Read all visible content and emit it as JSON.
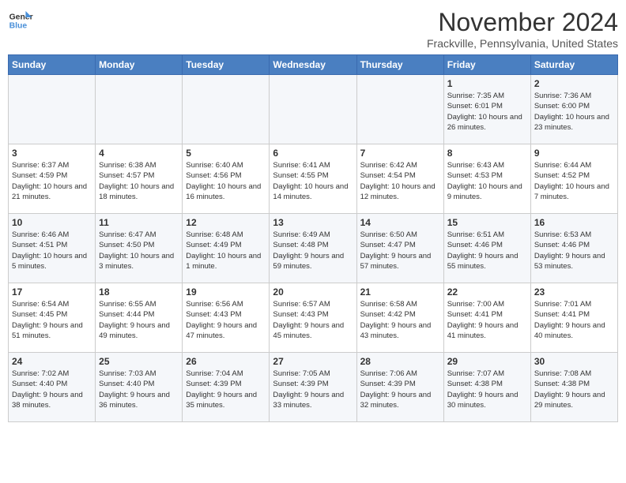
{
  "logo": {
    "line1": "General",
    "line2": "Blue"
  },
  "title": "November 2024",
  "subtitle": "Frackville, Pennsylvania, United States",
  "weekdays": [
    "Sunday",
    "Monday",
    "Tuesday",
    "Wednesday",
    "Thursday",
    "Friday",
    "Saturday"
  ],
  "weeks": [
    [
      {
        "day": "",
        "info": ""
      },
      {
        "day": "",
        "info": ""
      },
      {
        "day": "",
        "info": ""
      },
      {
        "day": "",
        "info": ""
      },
      {
        "day": "",
        "info": ""
      },
      {
        "day": "1",
        "info": "Sunrise: 7:35 AM\nSunset: 6:01 PM\nDaylight: 10 hours and 26 minutes."
      },
      {
        "day": "2",
        "info": "Sunrise: 7:36 AM\nSunset: 6:00 PM\nDaylight: 10 hours and 23 minutes."
      }
    ],
    [
      {
        "day": "3",
        "info": "Sunrise: 6:37 AM\nSunset: 4:59 PM\nDaylight: 10 hours and 21 minutes."
      },
      {
        "day": "4",
        "info": "Sunrise: 6:38 AM\nSunset: 4:57 PM\nDaylight: 10 hours and 18 minutes."
      },
      {
        "day": "5",
        "info": "Sunrise: 6:40 AM\nSunset: 4:56 PM\nDaylight: 10 hours and 16 minutes."
      },
      {
        "day": "6",
        "info": "Sunrise: 6:41 AM\nSunset: 4:55 PM\nDaylight: 10 hours and 14 minutes."
      },
      {
        "day": "7",
        "info": "Sunrise: 6:42 AM\nSunset: 4:54 PM\nDaylight: 10 hours and 12 minutes."
      },
      {
        "day": "8",
        "info": "Sunrise: 6:43 AM\nSunset: 4:53 PM\nDaylight: 10 hours and 9 minutes."
      },
      {
        "day": "9",
        "info": "Sunrise: 6:44 AM\nSunset: 4:52 PM\nDaylight: 10 hours and 7 minutes."
      }
    ],
    [
      {
        "day": "10",
        "info": "Sunrise: 6:46 AM\nSunset: 4:51 PM\nDaylight: 10 hours and 5 minutes."
      },
      {
        "day": "11",
        "info": "Sunrise: 6:47 AM\nSunset: 4:50 PM\nDaylight: 10 hours and 3 minutes."
      },
      {
        "day": "12",
        "info": "Sunrise: 6:48 AM\nSunset: 4:49 PM\nDaylight: 10 hours and 1 minute."
      },
      {
        "day": "13",
        "info": "Sunrise: 6:49 AM\nSunset: 4:48 PM\nDaylight: 9 hours and 59 minutes."
      },
      {
        "day": "14",
        "info": "Sunrise: 6:50 AM\nSunset: 4:47 PM\nDaylight: 9 hours and 57 minutes."
      },
      {
        "day": "15",
        "info": "Sunrise: 6:51 AM\nSunset: 4:46 PM\nDaylight: 9 hours and 55 minutes."
      },
      {
        "day": "16",
        "info": "Sunrise: 6:53 AM\nSunset: 4:46 PM\nDaylight: 9 hours and 53 minutes."
      }
    ],
    [
      {
        "day": "17",
        "info": "Sunrise: 6:54 AM\nSunset: 4:45 PM\nDaylight: 9 hours and 51 minutes."
      },
      {
        "day": "18",
        "info": "Sunrise: 6:55 AM\nSunset: 4:44 PM\nDaylight: 9 hours and 49 minutes."
      },
      {
        "day": "19",
        "info": "Sunrise: 6:56 AM\nSunset: 4:43 PM\nDaylight: 9 hours and 47 minutes."
      },
      {
        "day": "20",
        "info": "Sunrise: 6:57 AM\nSunset: 4:43 PM\nDaylight: 9 hours and 45 minutes."
      },
      {
        "day": "21",
        "info": "Sunrise: 6:58 AM\nSunset: 4:42 PM\nDaylight: 9 hours and 43 minutes."
      },
      {
        "day": "22",
        "info": "Sunrise: 7:00 AM\nSunset: 4:41 PM\nDaylight: 9 hours and 41 minutes."
      },
      {
        "day": "23",
        "info": "Sunrise: 7:01 AM\nSunset: 4:41 PM\nDaylight: 9 hours and 40 minutes."
      }
    ],
    [
      {
        "day": "24",
        "info": "Sunrise: 7:02 AM\nSunset: 4:40 PM\nDaylight: 9 hours and 38 minutes."
      },
      {
        "day": "25",
        "info": "Sunrise: 7:03 AM\nSunset: 4:40 PM\nDaylight: 9 hours and 36 minutes."
      },
      {
        "day": "26",
        "info": "Sunrise: 7:04 AM\nSunset: 4:39 PM\nDaylight: 9 hours and 35 minutes."
      },
      {
        "day": "27",
        "info": "Sunrise: 7:05 AM\nSunset: 4:39 PM\nDaylight: 9 hours and 33 minutes."
      },
      {
        "day": "28",
        "info": "Sunrise: 7:06 AM\nSunset: 4:39 PM\nDaylight: 9 hours and 32 minutes."
      },
      {
        "day": "29",
        "info": "Sunrise: 7:07 AM\nSunset: 4:38 PM\nDaylight: 9 hours and 30 minutes."
      },
      {
        "day": "30",
        "info": "Sunrise: 7:08 AM\nSunset: 4:38 PM\nDaylight: 9 hours and 29 minutes."
      }
    ]
  ]
}
